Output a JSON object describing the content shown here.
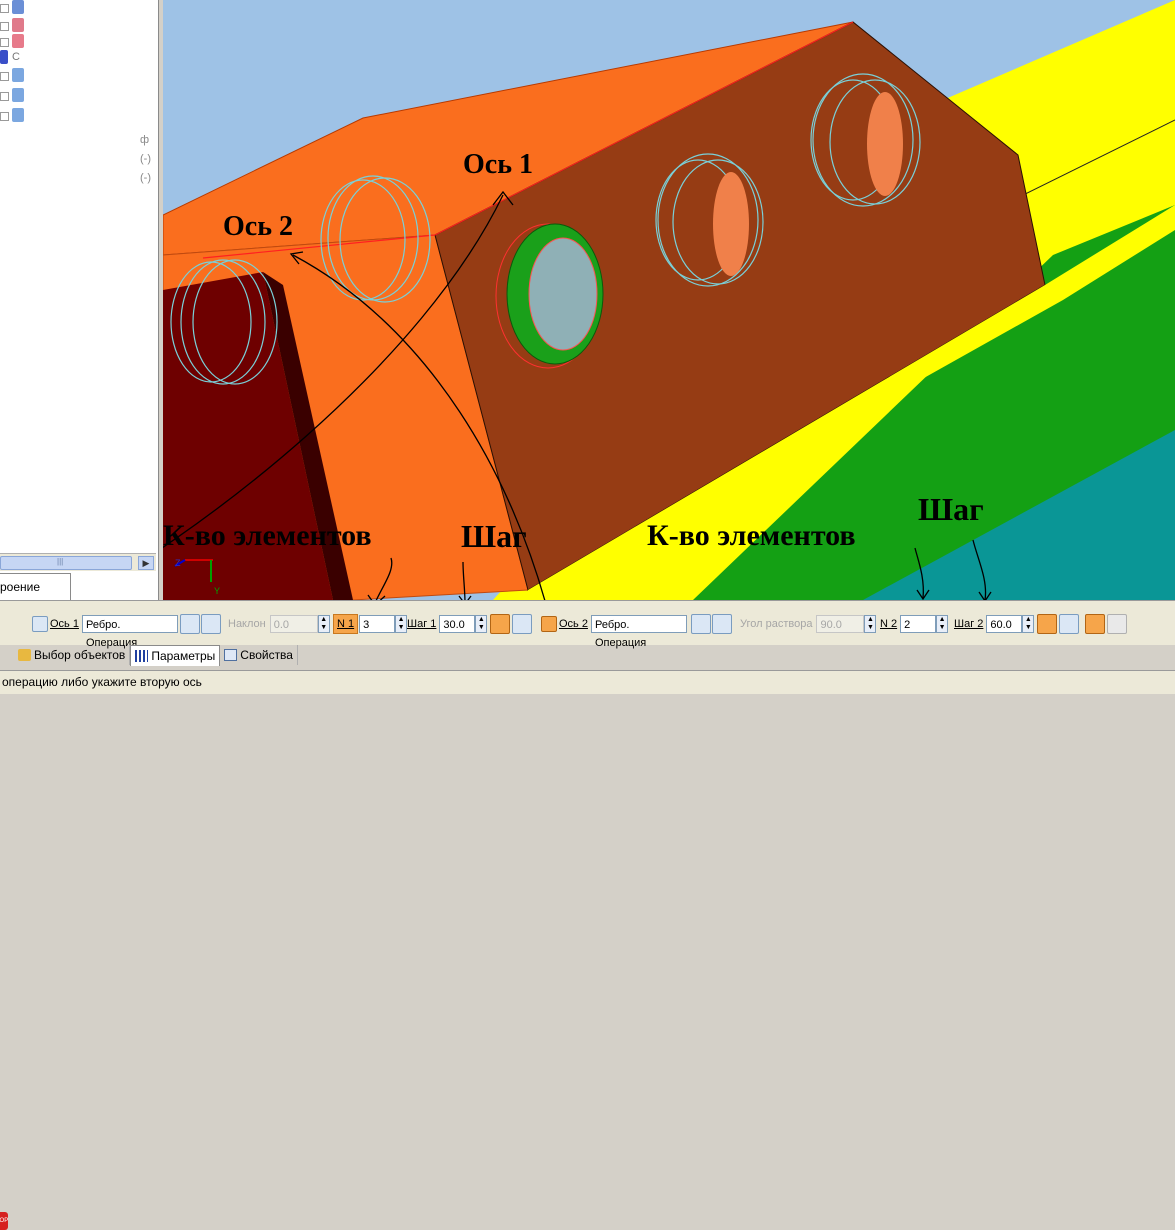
{
  "tree": {
    "icons": [
      "part-icon",
      "sketch-icon",
      "part-icon",
      "operation-icon",
      "part-icon",
      "part-icon",
      "part-icon"
    ],
    "c_label": "С",
    "side_chars": [
      "ф",
      "(-)",
      "(-)"
    ],
    "scroll_glyph": "|||",
    "tab_label": "роение"
  },
  "viewport": {
    "annotations": {
      "axis1": "Ось 1",
      "axis2": "Ось 2",
      "count_left": "К-во элементов",
      "step_left": "Шаг",
      "count_right": "К-во элементов",
      "step_right": "Шаг"
    },
    "triad": {
      "z": "Z",
      "y": "Y"
    },
    "colors": {
      "sky": "#9ec2e6",
      "orange": "#fa6e1e",
      "brown": "#963c14",
      "yellow": "#ffff00",
      "green": "#14a014",
      "teal": "#0a9696",
      "maroon": "#6e0000"
    }
  },
  "toolbar": {
    "axis1_label": "Ось 1",
    "axis1_value": "Ребро. Операция",
    "tilt_label": "Наклон",
    "tilt_value": "0.0",
    "n1_label": "N 1",
    "n1_value": "3",
    "step1_label": "Шаг 1",
    "step1_value": "30.0",
    "axis2_label": "Ось 2",
    "axis2_value": "Ребро. Операция",
    "angle_label": "Угол раствора",
    "angle_value": "90.0",
    "n2_label": "N 2",
    "n2_value": "2",
    "step2_label": "Шаг 2",
    "step2_value": "60.0"
  },
  "tabs": [
    {
      "label": "Выбор объектов",
      "icon": "select-objects-icon"
    },
    {
      "label": "Параметры",
      "icon": "parameters-icon"
    },
    {
      "label": "Свойства",
      "icon": "properties-icon"
    }
  ],
  "status": {
    "text": "операцию либо укажите вторую ось"
  }
}
